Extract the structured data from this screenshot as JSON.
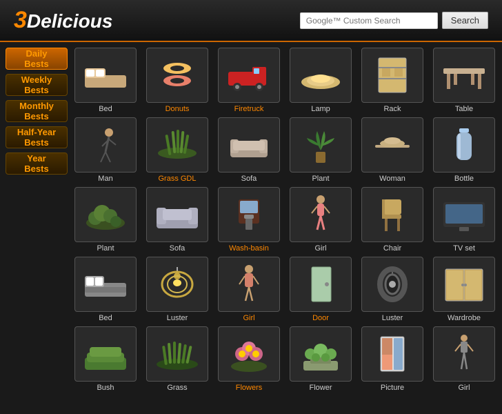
{
  "header": {
    "logo": "3Delicious",
    "logo_number": "3",
    "logo_text": "Delicious",
    "search_placeholder": "Google™ Custom Search",
    "search_label": "Search"
  },
  "sidebar": {
    "items": [
      {
        "id": "daily",
        "label": "Daily\nBests",
        "active": true
      },
      {
        "id": "weekly",
        "label": "Weekly\nBests",
        "active": false
      },
      {
        "id": "monthly",
        "label": "Monthly\nBests",
        "active": false
      },
      {
        "id": "halfyear",
        "label": "Half-Year\nBests",
        "active": false
      },
      {
        "id": "year",
        "label": "Year\nBests",
        "active": false
      }
    ]
  },
  "rows": [
    {
      "section": "daily",
      "items": [
        {
          "label": "Bed",
          "orange": false,
          "shape": "bed"
        },
        {
          "label": "Donuts",
          "orange": true,
          "shape": "donuts"
        },
        {
          "label": "Firetruck",
          "orange": true,
          "shape": "truck"
        },
        {
          "label": "Lamp",
          "orange": false,
          "shape": "lamp"
        },
        {
          "label": "Rack",
          "orange": false,
          "shape": "rack"
        },
        {
          "label": "Table",
          "orange": false,
          "shape": "table"
        }
      ]
    },
    {
      "section": "weekly",
      "items": [
        {
          "label": "Man",
          "orange": false,
          "shape": "man"
        },
        {
          "label": "Grass GDL",
          "orange": true,
          "shape": "grass"
        },
        {
          "label": "Sofa",
          "orange": false,
          "shape": "sofa"
        },
        {
          "label": "Plant",
          "orange": false,
          "shape": "plant"
        },
        {
          "label": "Woman",
          "orange": false,
          "shape": "woman"
        },
        {
          "label": "Bottle",
          "orange": false,
          "shape": "bottle"
        }
      ]
    },
    {
      "section": "monthly",
      "items": [
        {
          "label": "Plant",
          "orange": false,
          "shape": "plant2"
        },
        {
          "label": "Sofa",
          "orange": false,
          "shape": "sofa2"
        },
        {
          "label": "Wash-basin",
          "orange": true,
          "shape": "washbasin"
        },
        {
          "label": "Girl",
          "orange": false,
          "shape": "girl"
        },
        {
          "label": "Chair",
          "orange": false,
          "shape": "chair"
        },
        {
          "label": "TV set",
          "orange": false,
          "shape": "tv"
        }
      ]
    },
    {
      "section": "halfyear",
      "items": [
        {
          "label": "Bed",
          "orange": false,
          "shape": "bed2"
        },
        {
          "label": "Luster",
          "orange": false,
          "shape": "luster"
        },
        {
          "label": "Girl",
          "orange": true,
          "shape": "girl2"
        },
        {
          "label": "Door",
          "orange": true,
          "shape": "door"
        },
        {
          "label": "Luster",
          "orange": false,
          "shape": "luster2"
        },
        {
          "label": "Wardrobe",
          "orange": false,
          "shape": "wardrobe"
        }
      ]
    },
    {
      "section": "year",
      "items": [
        {
          "label": "Bush",
          "orange": false,
          "shape": "bush"
        },
        {
          "label": "Grass",
          "orange": false,
          "shape": "grass2"
        },
        {
          "label": "Flowers",
          "orange": true,
          "shape": "flowers"
        },
        {
          "label": "Flower",
          "orange": false,
          "shape": "flower"
        },
        {
          "label": "Picture",
          "orange": false,
          "shape": "picture"
        },
        {
          "label": "Girl",
          "orange": false,
          "shape": "girl3"
        }
      ]
    }
  ]
}
